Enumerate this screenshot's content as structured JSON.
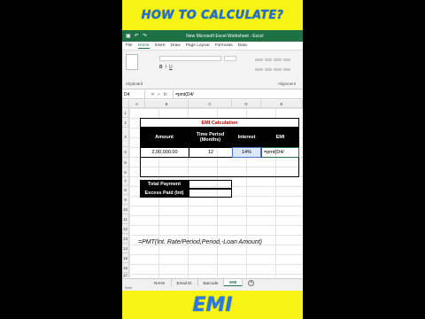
{
  "banner_top": "HOW TO CALCULATE?",
  "banner_bottom": "EMI",
  "window": {
    "title": "New Microsoft Excel Worksheet - Excel",
    "undo_icon": "undo-icon",
    "redo_icon": "redo-icon"
  },
  "menu": [
    "File",
    "Home",
    "Insert",
    "Draw",
    "Page Layout",
    "Formulas",
    "Data"
  ],
  "ribbon": {
    "clipboard_label": "Clipboard",
    "alignment_label": "Alignment",
    "format_buttons": [
      "B",
      "I",
      "U"
    ]
  },
  "formula_bar": {
    "name_box": "D4",
    "fx_label": "fx",
    "value": "=pmt(D4/"
  },
  "columns": [
    "A",
    "B",
    "C",
    "D",
    "E"
  ],
  "rows": [
    "1",
    "2",
    "3",
    "4",
    "5",
    "6",
    "7",
    "8",
    "9",
    "10",
    "11",
    "12",
    "13",
    "14",
    "15",
    "16",
    "17"
  ],
  "sheet": {
    "emi_title": "EMI Calculation",
    "headers": [
      "Amount",
      "Time Period (Months)",
      "Interest",
      "EMI"
    ],
    "amount": "2,00,000.00",
    "months": "12",
    "interest": "14%",
    "emi_formula": "=pmt(D4/",
    "total_payment": "Total Payment",
    "excess_paid": "Excess Paid (Int)"
  },
  "formula_note": "=PMT(Int. Rate/Period,Period,-Loan Amount)",
  "tabs": [
    "RAHK",
    "Email ID",
    "Barcode",
    "EMI"
  ],
  "active_tab": "EMI",
  "status": "Enter",
  "colors": {
    "excel_green": "#1e7145",
    "banner_yellow": "#f7f414",
    "banner_text": "#1f6fd6",
    "title_red": "#c00000"
  }
}
